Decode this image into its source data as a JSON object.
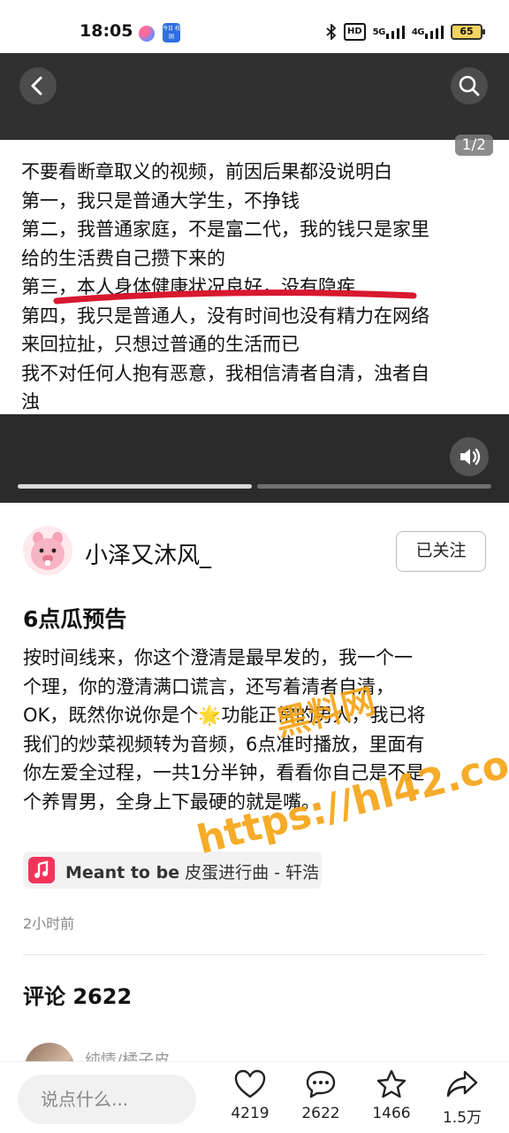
{
  "status_bar": {
    "time": "18:05",
    "app_icon_label": "今日\n校园",
    "hd_label": "HD",
    "signal_1": "5G",
    "signal_2": "4G",
    "battery": "65"
  },
  "media": {
    "page_counter": "1/2",
    "slide_lines": [
      "不要看断章取义的视频，前因后果都没说明白",
      "第一，我只是普通大学生，不挣钱",
      "第二，我普通家庭，不是富二代，我的钱只是家里",
      "给的生活费自己攒下来的",
      "第三，本人身体健康状况良好，没有隐疾",
      "第四，我只是普通人，没有时间也没有精力在网络",
      "来回拉扯，只想过普通的生活而已",
      "我不对任何人抱有恶意，我相信清者自清，浊者自",
      "浊"
    ],
    "progress_segments": 2,
    "active_segment": 1
  },
  "author": {
    "name": "小泽又沐风_",
    "follow_label": "已关注"
  },
  "post": {
    "title": "6点瓜预告",
    "body_lines": [
      "按时间线来，你这个澄清是最早发的，我一个一",
      "个理，你的澄清满口谎言，还写着清者自清，",
      "OK，既然你说你是个🌟功能正常的男人，我已将",
      "我们的炒菜视频转为音频，6点准时播放，里面有",
      "你左爱全过程，一共1分半钟，看看你自己是不是",
      "个养胃男，全身上下最硬的就是嘴。"
    ],
    "music_title": "Meant to be",
    "music_rest": " 皮蛋进行曲 - 轩浩",
    "time_ago": "2小时前"
  },
  "watermark": {
    "line1": "黑料网",
    "line2": "https://hl42.co"
  },
  "comments": {
    "title": "评论 2622",
    "first_user": "纯情/橘子皮"
  },
  "bottom_bar": {
    "input_placeholder": "说点什么...",
    "likes": "4219",
    "comments": "2622",
    "favorites": "1466",
    "shares": "1.5万"
  },
  "colors": {
    "underline_red": "#d8182f",
    "watermark_orange": "#f5a417",
    "music_red": "#f2345a"
  }
}
